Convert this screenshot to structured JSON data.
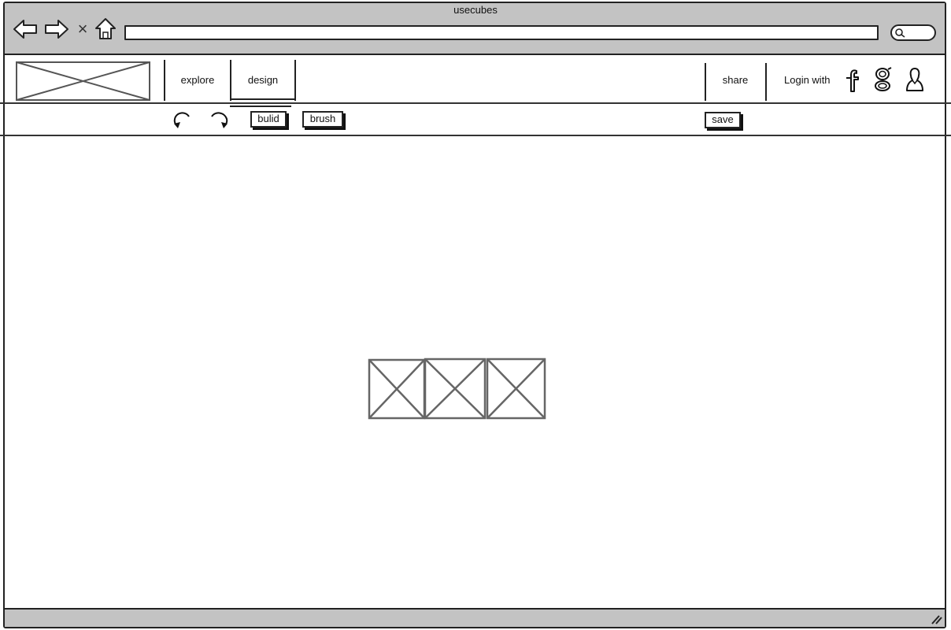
{
  "window": {
    "title": "usecubes"
  },
  "browser": {
    "back_icon": "back-arrow-icon",
    "forward_icon": "forward-arrow-icon",
    "close_glyph": "×",
    "home_icon": "home-icon",
    "address_value": "",
    "search_icon": "search-icon"
  },
  "nav": {
    "logo": "image-placeholder",
    "items": [
      {
        "label": "explore"
      },
      {
        "label": "design",
        "active": true
      },
      {
        "label": "share"
      }
    ],
    "login_label": "Login with",
    "login_icons": [
      "facebook-icon",
      "google-icon",
      "user-icon"
    ]
  },
  "toolbar": {
    "undo_icon": "undo-icon",
    "redo_icon": "redo-icon",
    "build_label": "bulid",
    "brush_label": "brush",
    "save_label": "save"
  },
  "canvas": {
    "placeholders": [
      "image-placeholder",
      "image-placeholder",
      "image-placeholder"
    ]
  },
  "colors": {
    "chrome": "#c3c3c3",
    "stroke": "#222222",
    "placeholder_stroke": "#666666",
    "background": "#ffffff"
  }
}
